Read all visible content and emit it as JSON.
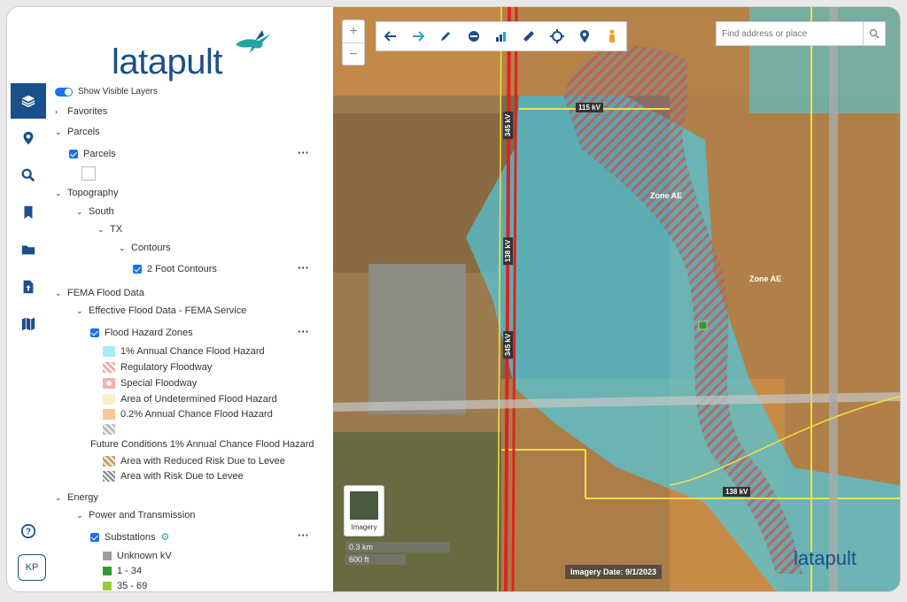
{
  "app": {
    "brand": "latapult",
    "close_label": "×"
  },
  "rail": {
    "items": [
      {
        "name": "layers-icon"
      },
      {
        "name": "location-pin-icon"
      },
      {
        "name": "search-icon"
      },
      {
        "name": "bookmark-icon"
      },
      {
        "name": "folder-icon"
      },
      {
        "name": "upload-icon"
      },
      {
        "name": "map-icon"
      },
      {
        "name": "help-icon"
      }
    ],
    "user_initials": "KP",
    "active_color": "#1a4f8b"
  },
  "layers": {
    "show_visible_label": "Show Visible Layers",
    "favorites": "Favorites",
    "parcels_group": "Parcels",
    "parcels_layer": "Parcels",
    "topography": "Topography",
    "south": "South",
    "tx": "TX",
    "contours": "Contours",
    "two_foot": "2 Foot Contours",
    "fema": "FEMA Flood Data",
    "effective": "Effective Flood Data - FEMA Service",
    "flood_zones": "Flood Hazard Zones",
    "legend": [
      {
        "label": "1% Annual Chance Flood Hazard",
        "color": "#a8ecf4"
      },
      {
        "label": "Regulatory Floodway",
        "color": "#f2a6a6"
      },
      {
        "label": "Special Floodway",
        "color": "#f4b0b0"
      },
      {
        "label": "Area of Undetermined Flood Hazard",
        "color": "#fbeecb"
      },
      {
        "label": "0.2% Annual Chance Flood Hazard",
        "color": "#f6c89a"
      },
      {
        "label": "",
        "color": "#bdbdbd"
      }
    ],
    "future_conditions": "Future Conditions 1% Annual Chance Flood Hazard",
    "levee": [
      {
        "label": "Area with Reduced Risk Due to Levee"
      },
      {
        "label": "Area with Risk Due to Levee"
      }
    ],
    "energy": "Energy",
    "power": "Power and Transmission",
    "substations": "Substations",
    "kv_legend": [
      {
        "label": "Unknown kV",
        "color": "#9e9e9e"
      },
      {
        "label": "1 - 34",
        "color": "#2e9e2e"
      },
      {
        "label": "35 - 69",
        "color": "#9ccc3a"
      }
    ]
  },
  "map": {
    "search_placeholder": "Find address or place",
    "zoom_in": "+",
    "zoom_out": "−",
    "imagery_label": "Imagery",
    "scale_km": "0.3 km",
    "scale_ft": "600 ft",
    "imagery_date": "Imagery Date: 9/1/2023",
    "watermark": "latapult",
    "labels": {
      "zone_ae_1": "Zone AE",
      "zone_ae_2": "Zone AE",
      "kv115": "115 kV",
      "kv138": "138 kV",
      "kv345a": "345 kV",
      "kv345b": "345 kV",
      "kv138a": "138 kV"
    },
    "toolbar_icons": [
      "arrow-left-icon",
      "arrow-right-icon",
      "pencil-icon",
      "circle-icon",
      "chart-icon",
      "ruler-icon",
      "crosshair-icon",
      "pin-icon",
      "person-icon"
    ]
  }
}
